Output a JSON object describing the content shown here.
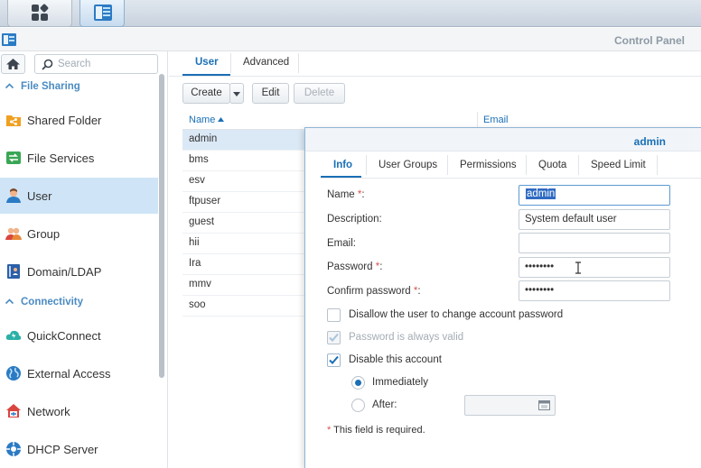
{
  "window": {
    "title": "Control Panel"
  },
  "sidebar": {
    "search_placeholder": "Search",
    "sections": [
      {
        "label": "File Sharing"
      },
      {
        "label": "Connectivity"
      }
    ],
    "items": [
      {
        "label": "Shared Folder"
      },
      {
        "label": "File Services"
      },
      {
        "label": "User"
      },
      {
        "label": "Group"
      },
      {
        "label": "Domain/LDAP"
      },
      {
        "label": "QuickConnect"
      },
      {
        "label": "External Access"
      },
      {
        "label": "Network"
      },
      {
        "label": "DHCP Server"
      }
    ]
  },
  "main": {
    "tabs": [
      {
        "label": "User"
      },
      {
        "label": "Advanced"
      }
    ],
    "toolbar": {
      "create": "Create",
      "edit": "Edit",
      "delete": "Delete"
    },
    "columns": {
      "name": "Name",
      "email": "Email"
    },
    "users": [
      "admin",
      "bms",
      "esv",
      "ftpuser",
      "guest",
      "hii",
      "Ira",
      "mmv",
      "soo"
    ]
  },
  "dialog": {
    "title": "admin",
    "tabs": [
      {
        "label": "Info"
      },
      {
        "label": "User Groups"
      },
      {
        "label": "Permissions"
      },
      {
        "label": "Quota"
      },
      {
        "label": "Speed Limit"
      }
    ],
    "fields": {
      "name_label": "Name",
      "name_value": "admin",
      "description_label": "Description:",
      "description_value": "System default user",
      "email_label": "Email:",
      "email_value": "",
      "password_label": "Password",
      "password_value": "••••••••",
      "confirm_label": "Confirm password",
      "confirm_value": "••••••••",
      "required_mark": "*",
      "colon": ":"
    },
    "options": {
      "disallow_change": "Disallow the user to change account password",
      "always_valid": "Password is always valid",
      "disable_account": "Disable this account",
      "immediately": "Immediately",
      "after": "After:"
    },
    "required_note": "This field is required."
  },
  "colors": {
    "accent": "#1a6fb5",
    "selection": "#cfe5f7",
    "required": "#d9534f"
  }
}
